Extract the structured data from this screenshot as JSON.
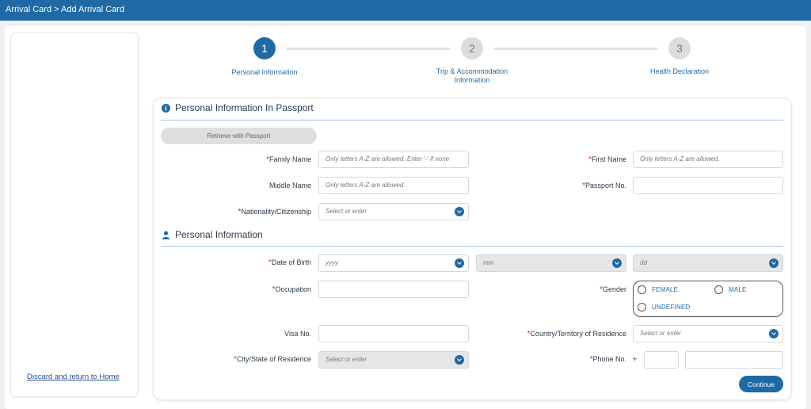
{
  "header": {
    "breadcrumb": "Arrival Card > Add Arrival Card"
  },
  "sidebar": {
    "discard_link": "Discard and return to Home"
  },
  "stepper": {
    "steps": [
      {
        "number": "1",
        "label": "Personal Information",
        "state": "active"
      },
      {
        "number": "2",
        "label": "Trip & Accommodation Information",
        "state": "inactive"
      },
      {
        "number": "3",
        "label": "Health Declaration",
        "state": "inactive"
      }
    ]
  },
  "passport_section": {
    "title": "Personal Information In Passport",
    "icon": "info-icon",
    "retrieve_button": "Retrieve with Passport",
    "fields": {
      "family_name": {
        "label": "Family Name",
        "required": "*",
        "placeholder": "Only letters A-Z are allowed. Enter '-' if none",
        "value": ""
      },
      "first_name": {
        "label": "First Name",
        "required": "*",
        "placeholder": "Only letters A-Z are allowed.",
        "value": ""
      },
      "middle_name": {
        "label": "Middle Name",
        "placeholder": "Only letters A-Z are allowed.",
        "value": ""
      },
      "passport_no": {
        "label": "Passport No.",
        "required": "*",
        "placeholder": "",
        "value": ""
      },
      "nationality": {
        "label": "Nationality/Citizenship",
        "required": "*",
        "placeholder": "Select or enter"
      }
    }
  },
  "personal_section": {
    "title": "Personal Information",
    "icon": "person-icon",
    "fields": {
      "dob": {
        "label": "Date of Birth",
        "required": "*",
        "year_placeholder": "yyyy",
        "month_placeholder": "mm",
        "day_placeholder": "dd"
      },
      "occupation": {
        "label": "Occupation",
        "required": "*",
        "value": ""
      },
      "gender": {
        "label": "Gender",
        "required": "*",
        "options": [
          "FEMALE",
          "MALE",
          "UNDEFINED"
        ]
      },
      "visa_no": {
        "label": "Visa No.",
        "value": ""
      },
      "country_residence": {
        "label": "Country/Territory of Residence",
        "required": "*",
        "placeholder": "Select or enter"
      },
      "city_residence": {
        "label": "City/State of Residence",
        "required": "*",
        "placeholder": "Select or enter"
      },
      "phone": {
        "label": "Phone No.",
        "required": "*",
        "prefix": "+"
      }
    }
  },
  "actions": {
    "continue": "Continue"
  },
  "colors": {
    "primary": "#1f6aa5",
    "required": "#d9262e",
    "disabled": "#e6e6e6"
  }
}
